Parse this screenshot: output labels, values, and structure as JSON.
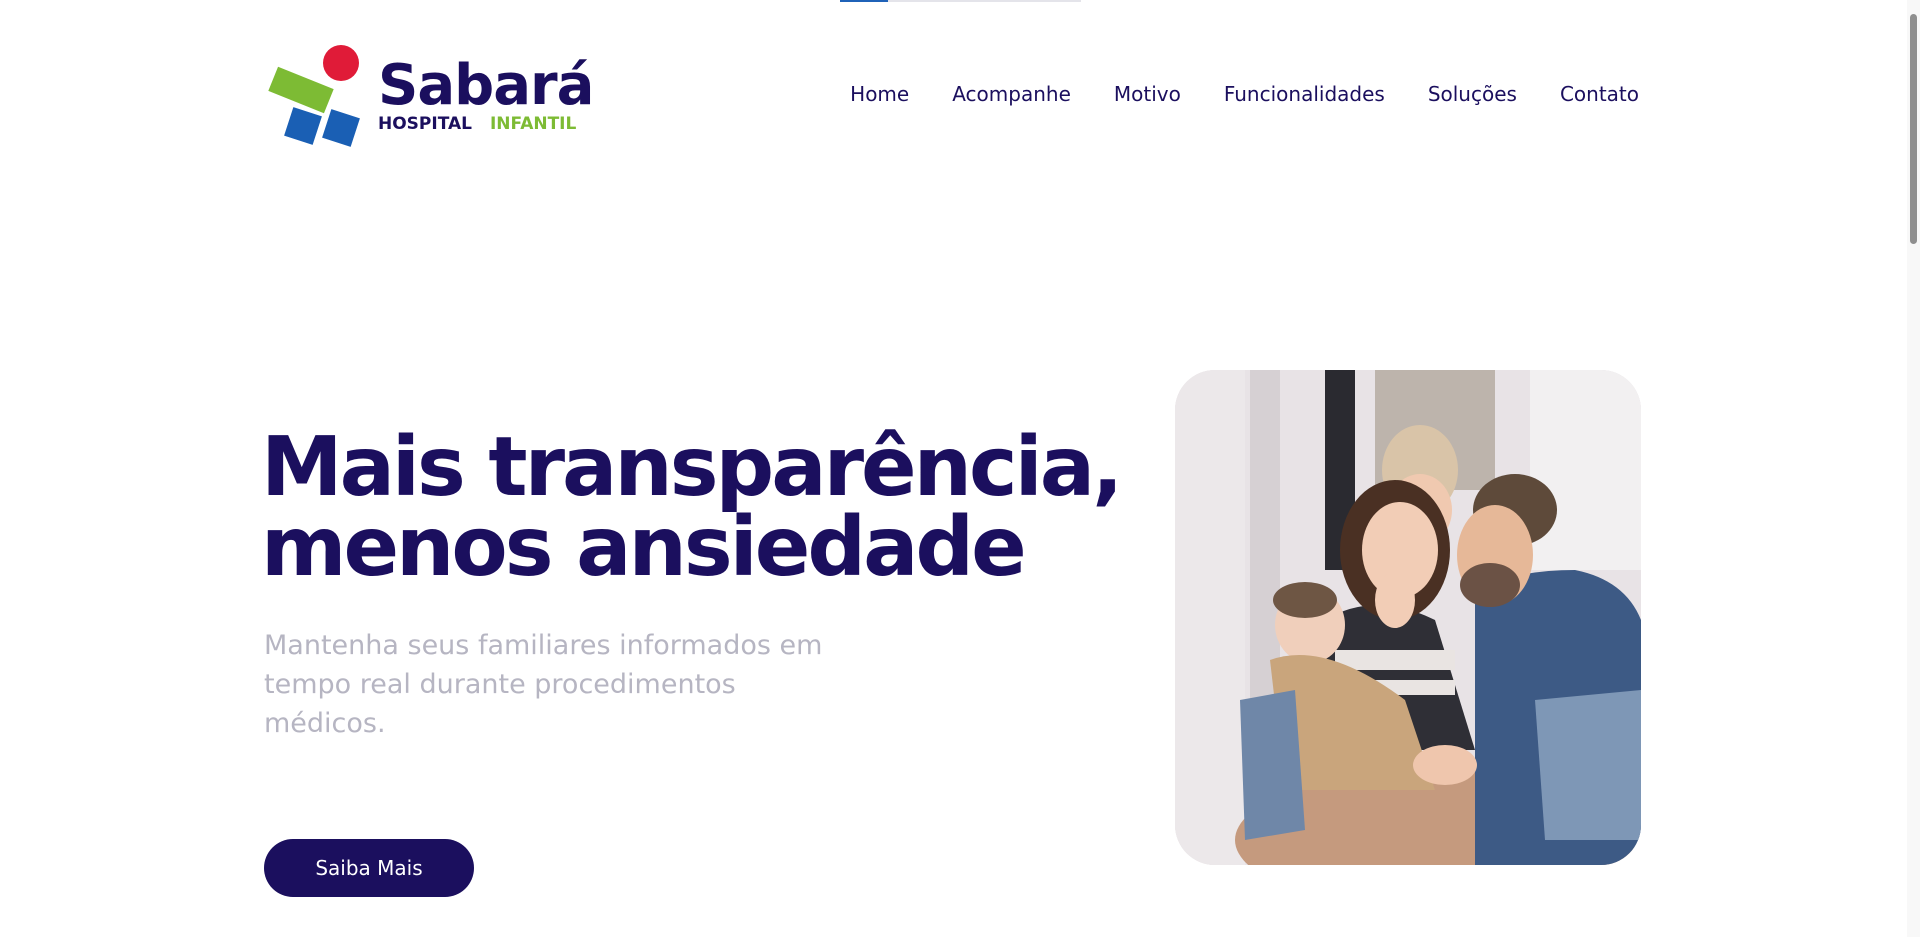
{
  "page": {
    "top_progress_fraction": 0.2
  },
  "brand": {
    "name": "Sabará",
    "sub_left": "HOSPITAL",
    "sub_right": "INFANTIL"
  },
  "nav": {
    "items": [
      "Home",
      "Acompanhe",
      "Motivo",
      "Funcionalidades",
      "Soluções",
      "Contato"
    ]
  },
  "hero": {
    "title_line1": "Mais transparência,",
    "title_line2": "menos ansiedade",
    "subtitle": "Mantenha seus familiares informados em tempo real durante procedimentos médicos.",
    "cta_label": "Saiba Mais"
  },
  "colors": {
    "primary": "#1b0f5e",
    "accent_green": "#7dbb34",
    "accent_red": "#e01b38",
    "accent_blue": "#1a5fb4",
    "subtitle_gray": "#b6b5c2"
  }
}
